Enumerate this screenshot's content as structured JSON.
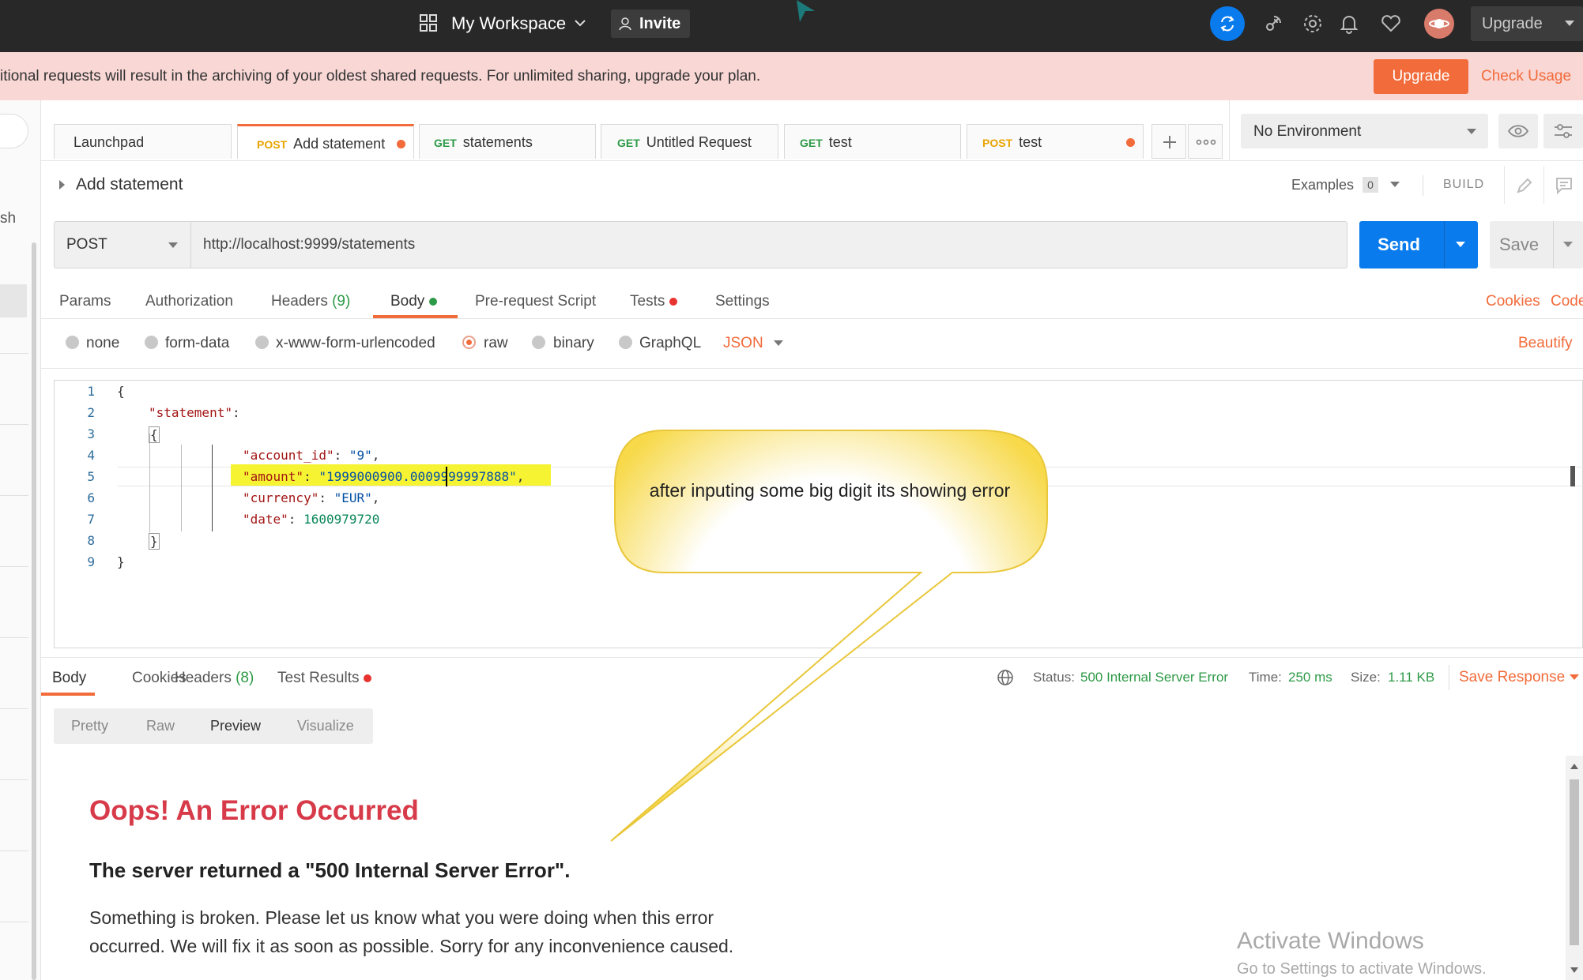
{
  "topbar": {
    "workspace_label": "My Workspace",
    "invite_label": "Invite",
    "upgrade_label": "Upgrade"
  },
  "banner": {
    "text": "itional requests will result in the archiving of your oldest shared requests. For unlimited sharing, upgrade your plan.",
    "upgrade_button": "Upgrade",
    "check_usage_link": "Check Usage"
  },
  "sidebar": {
    "partial_text": "sh"
  },
  "tabs": [
    {
      "method": "",
      "label": "Launchpad",
      "unsaved": false
    },
    {
      "method": "POST",
      "label": "Add statement",
      "unsaved": true
    },
    {
      "method": "GET",
      "label": "statements",
      "unsaved": false
    },
    {
      "method": "GET",
      "label": "Untitled Request",
      "unsaved": false
    },
    {
      "method": "GET",
      "label": "test",
      "unsaved": false
    },
    {
      "method": "POST",
      "label": "test",
      "unsaved": true
    }
  ],
  "environment": {
    "selected": "No Environment"
  },
  "request": {
    "name": "Add statement",
    "examples_label": "Examples",
    "examples_count": "0",
    "build_label": "BUILD",
    "method": "POST",
    "url": "http://localhost:9999/statements",
    "send_label": "Send",
    "save_label": "Save"
  },
  "request_tabs": {
    "params": "Params",
    "authorization": "Authorization",
    "headers": "Headers",
    "headers_count": "(9)",
    "body": "Body",
    "prerequest": "Pre-request Script",
    "tests": "Tests",
    "settings": "Settings",
    "cookies": "Cookies",
    "code": "Code"
  },
  "body_types": {
    "none": "none",
    "form_data": "form-data",
    "urlencoded": "x-www-form-urlencoded",
    "raw": "raw",
    "binary": "binary",
    "graphql": "GraphQL",
    "format": "JSON",
    "beautify": "Beautify"
  },
  "editor": {
    "line_numbers": [
      "1",
      "2",
      "3",
      "4",
      "5",
      "6",
      "7",
      "8",
      "9"
    ],
    "l1": "{",
    "l2_key": "\"statement\"",
    "l2_colon": ":",
    "l3": "{",
    "l4_key": "\"account_id\"",
    "l4_colon": ": ",
    "l4_val": "\"9\"",
    "l4_comma": ",",
    "l5_key": "\"amount\"",
    "l5_colon": ": ",
    "l5_val": "\"1999000900.0009999997888\"",
    "l5_comma": ",",
    "l6_key": "\"currency\"",
    "l6_colon": ": ",
    "l6_val": "\"EUR\"",
    "l6_comma": ",",
    "l7_key": "\"date\"",
    "l7_colon": ": ",
    "l7_val": "1600979720",
    "l8": "}",
    "l9": "}"
  },
  "callout": {
    "text": "after inputing some big digit its showing error"
  },
  "response": {
    "tabs": {
      "body": "Body",
      "cookies": "Cookies",
      "headers": "Headers",
      "headers_count": "(8)",
      "test_results": "Test Results"
    },
    "status_label": "Status:",
    "status_value": "500 Internal Server Error",
    "time_label": "Time:",
    "time_value": "250 ms",
    "size_label": "Size:",
    "size_value": "1.11 KB",
    "save_response": "Save Response",
    "views": {
      "pretty": "Pretty",
      "raw": "Raw",
      "preview": "Preview",
      "visualize": "Visualize"
    },
    "preview": {
      "title": "Oops! An Error Occurred",
      "subtitle": "The server returned a \"500 Internal Server Error\".",
      "line1": "Something is broken. Please let us know what you were doing when this error",
      "line2": "occurred. We will fix it as soon as possible. Sorry for any inconvenience caused."
    }
  },
  "watermark": {
    "title": "Activate Windows",
    "subtitle": "Go to Settings to activate Windows."
  },
  "colors": {
    "accent": "#f26b3a",
    "send_blue": "#097bed",
    "success_green": "#2d9a47",
    "error_red": "#d73a49"
  }
}
